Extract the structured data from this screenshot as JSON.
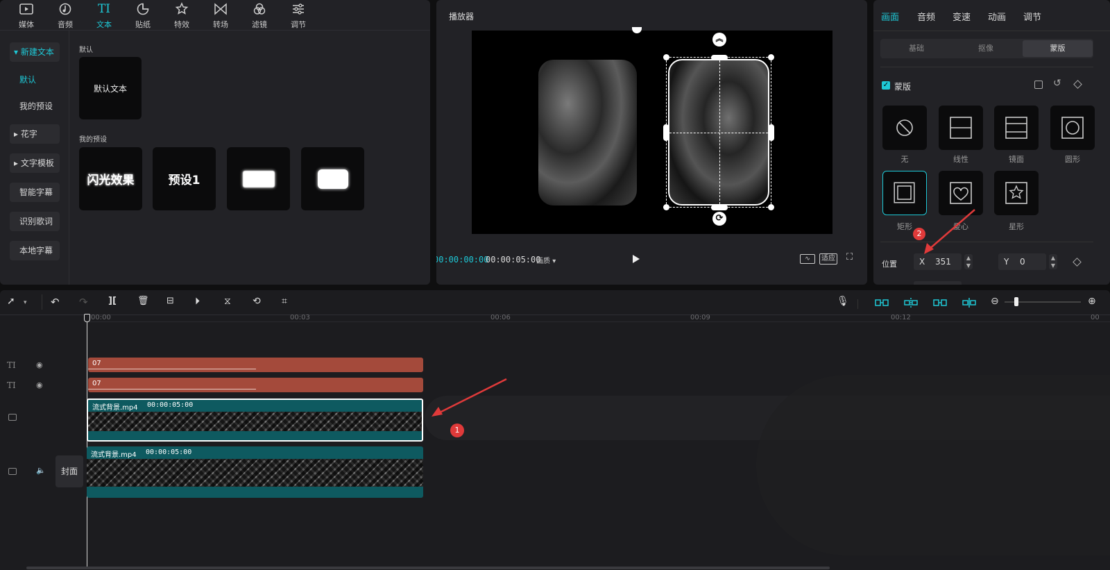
{
  "tabs": [
    {
      "label": "媒体",
      "icon": "media-icon"
    },
    {
      "label": "音频",
      "icon": "audio-icon"
    },
    {
      "label": "文本",
      "icon": "text-icon",
      "glyph": "TI"
    },
    {
      "label": "贴纸",
      "icon": "sticker-icon"
    },
    {
      "label": "特效",
      "icon": "effects-icon"
    },
    {
      "label": "转场",
      "icon": "transition-icon"
    },
    {
      "label": "滤镜",
      "icon": "filter-icon"
    },
    {
      "label": "调节",
      "icon": "adjust-icon"
    }
  ],
  "sidebar": {
    "items": [
      {
        "label": "▾ 新建文本"
      },
      {
        "label": "默认"
      },
      {
        "label": "我的预设"
      },
      {
        "label": "▸ 花字"
      },
      {
        "label": "▸ 文字模板"
      },
      {
        "label": "智能字幕"
      },
      {
        "label": "识别歌词"
      },
      {
        "label": "本地字幕"
      }
    ]
  },
  "library": {
    "default_heading": "默认",
    "default_card": "默认文本",
    "my_presets_heading": "我的预设",
    "presets": [
      "闪光效果",
      "预设1",
      "",
      ""
    ]
  },
  "player": {
    "title": "播放器",
    "current_time": "00:00:00:00",
    "total_time": "00:00:05:00",
    "quality": "画质",
    "fit_label": "适应"
  },
  "inspector": {
    "tabs": [
      "画面",
      "音频",
      "变速",
      "动画",
      "调节"
    ],
    "segments": [
      "基础",
      "抠像",
      "蒙版"
    ],
    "mask_section": "蒙版",
    "masks": [
      {
        "label": "无",
        "icon": "no-mask-icon"
      },
      {
        "label": "线性",
        "icon": "linear-mask-icon"
      },
      {
        "label": "镜面",
        "icon": "mirror-mask-icon"
      },
      {
        "label": "圆形",
        "icon": "circle-mask-icon"
      },
      {
        "label": "矩形",
        "icon": "rectangle-mask-icon"
      },
      {
        "label": "爱心",
        "icon": "heart-mask-icon"
      },
      {
        "label": "星形",
        "icon": "star-mask-icon"
      }
    ],
    "position_label": "位置",
    "x_label": "X",
    "x_value": "351",
    "y_label": "Y",
    "y_value": "0"
  },
  "timeline": {
    "ruler": [
      "00:00",
      "00:03",
      "00:06",
      "00:09",
      "00:12",
      "00"
    ],
    "text_clips": [
      "07",
      "07"
    ],
    "video_clips": [
      {
        "name": "流式背景.mp4",
        "duration": "00:00:05:00"
      },
      {
        "name": "流式背景.mp4",
        "duration": "00:00:05:00"
      }
    ],
    "cover_label": "封面"
  },
  "annotations": [
    "1",
    "2"
  ],
  "colors": {
    "accent": "#1ec8d6",
    "text_clip": "#a44a3b",
    "video_clip": "#0e5a60",
    "marker": "#e03a3a"
  }
}
